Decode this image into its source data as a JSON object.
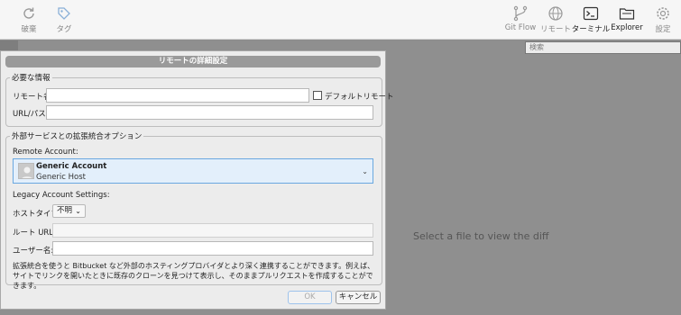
{
  "toolbar": {
    "left": [
      {
        "label": "破棄",
        "icon": "discard-icon"
      },
      {
        "label": "タグ",
        "icon": "tag-icon"
      }
    ],
    "right": [
      {
        "label": "Git Flow",
        "icon": "git-flow-icon"
      },
      {
        "label": "リモート",
        "icon": "remote-globe-icon"
      },
      {
        "label": "ターミナル",
        "icon": "terminal-icon"
      },
      {
        "label": "Explorer",
        "icon": "folder-icon"
      },
      {
        "label": "設定",
        "icon": "gear-icon"
      }
    ]
  },
  "search": {
    "placeholder": "検索"
  },
  "diff_panel": {
    "message": "Select a file to view the diff"
  },
  "dialog": {
    "title": "リモートの詳細設定",
    "required_section": {
      "legend": "必要な情報",
      "remote_name_label": "リモート名:",
      "remote_name_value": "",
      "default_remote_label": "デフォルトリモート",
      "default_remote_checked": false,
      "url_label": "URL/パス:",
      "url_value": ""
    },
    "integration_section": {
      "legend": "外部サービスとの拡張統合オプション",
      "remote_account_label": "Remote Account:",
      "account_name": "Generic Account",
      "account_host": "Generic Host",
      "legacy_label": "Legacy Account Settings:",
      "host_type_label": "ホストタイプ:",
      "host_type_value": "不明",
      "root_url_label": "ルート URL:",
      "root_url_value": "",
      "username_label": "ユーザー名:",
      "username_value": "",
      "description": "拡張統合を使うと Bitbucket など外部のホスティングプロバイダとより深く連携することができます。例えば、サイトでリンクを開いたときに既存のクローンを見つけて表示し、そのままプルリクエストを作成することができます。"
    },
    "ok_label": "OK",
    "cancel_label": "キャンセル"
  }
}
